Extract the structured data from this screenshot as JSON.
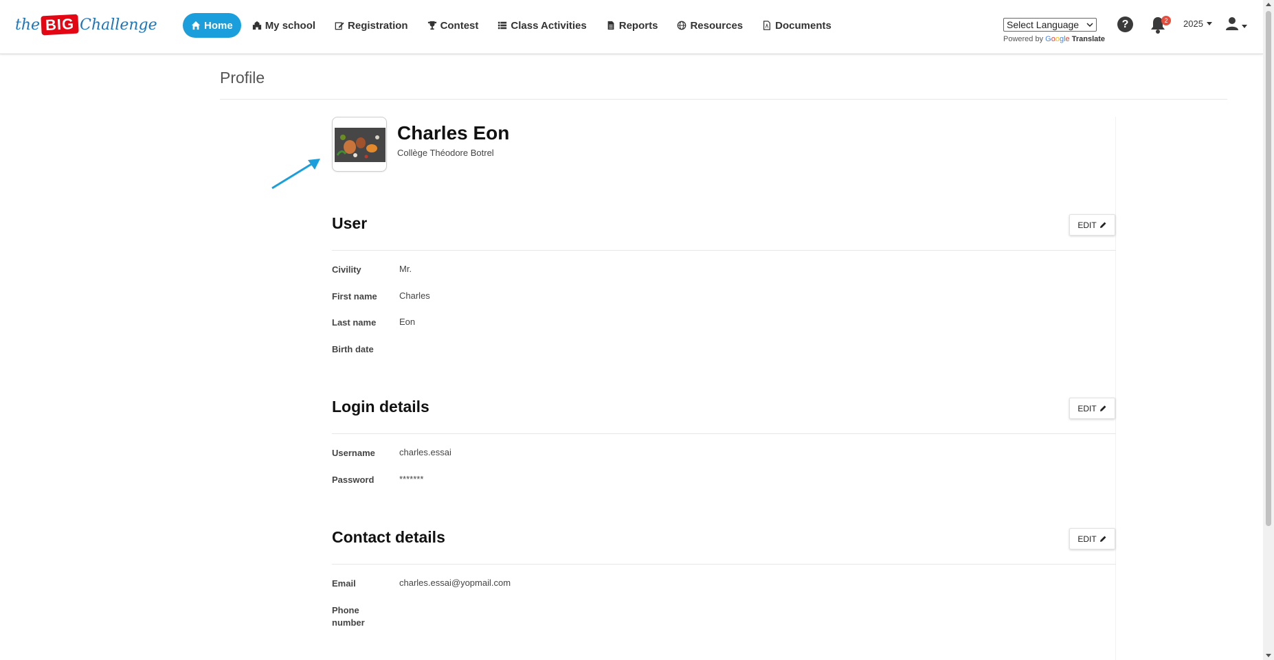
{
  "header": {
    "logo": {
      "the": "the",
      "big": "BIG",
      "challenge": "Challenge"
    },
    "nav": [
      {
        "label": "Home",
        "icon": "home-icon"
      },
      {
        "label": "My school",
        "icon": "school-icon"
      },
      {
        "label": "Registration",
        "icon": "edit-icon"
      },
      {
        "label": "Contest",
        "icon": "trophy-icon"
      },
      {
        "label": "Class Activities",
        "icon": "list-icon"
      },
      {
        "label": "Reports",
        "icon": "file-icon"
      },
      {
        "label": "Resources",
        "icon": "globe-icon"
      },
      {
        "label": "Documents",
        "icon": "pdf-icon"
      }
    ],
    "language_select": "Select Language",
    "powered_by": "Powered by",
    "google": [
      "G",
      "o",
      "o",
      "g",
      "l",
      "e"
    ],
    "translate": "Translate",
    "notification_count": "2",
    "year": "2025"
  },
  "page": {
    "title": "Profile"
  },
  "profile": {
    "name": "Charles Eon",
    "school": "Collège Théodore Botrel"
  },
  "sections": {
    "user": {
      "title": "User",
      "edit_label": "EDIT",
      "fields": [
        {
          "label": "Civility",
          "value": "Mr."
        },
        {
          "label": "First name",
          "value": "Charles"
        },
        {
          "label": "Last name",
          "value": "Eon"
        },
        {
          "label": "Birth date",
          "value": ""
        }
      ]
    },
    "login": {
      "title": "Login details",
      "edit_label": "EDIT",
      "fields": [
        {
          "label": "Username",
          "value": "charles.essai"
        },
        {
          "label": "Password",
          "value": "*******"
        }
      ]
    },
    "contact": {
      "title": "Contact details",
      "edit_label": "EDIT",
      "fields": [
        {
          "label": "Email",
          "value": "charles.essai@yopmail.com"
        },
        {
          "label": "Phone number",
          "value": ""
        }
      ]
    }
  },
  "colors": {
    "accent": "#1a9fdc",
    "brand_red": "#e30613",
    "brand_blue": "#1b75bc",
    "badge": "#e74c3c",
    "annotation_arrow": "#1a9fdc"
  }
}
